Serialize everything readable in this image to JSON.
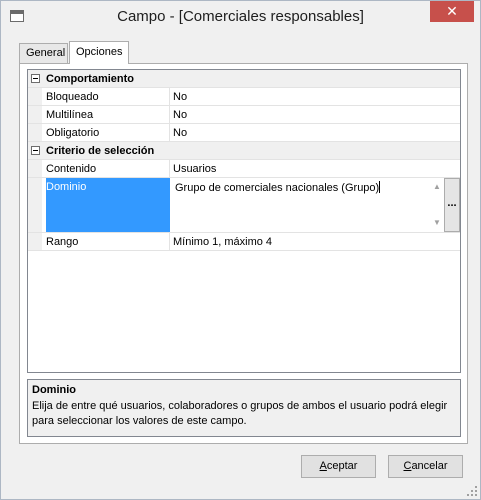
{
  "window": {
    "title": "Campo - [Comerciales responsables]",
    "close_label": "✕"
  },
  "tabs": [
    {
      "label": "General"
    },
    {
      "label": "Opciones"
    }
  ],
  "grid": {
    "categories": [
      {
        "label": "Comportamiento",
        "expander": "−"
      },
      {
        "label": "Criterio de selección",
        "expander": "−"
      }
    ],
    "properties": {
      "bloqueado": {
        "name": "Bloqueado",
        "value": "No"
      },
      "multilinea": {
        "name": "Multilínea",
        "value": "No"
      },
      "obligatorio": {
        "name": "Obligatorio",
        "value": "No"
      },
      "contenido": {
        "name": "Contenido",
        "value": "Usuarios"
      },
      "dominio": {
        "name": "Dominio",
        "value": "Grupo de comerciales nacionales (Grupo)"
      },
      "rango": {
        "name": "Rango",
        "value": "Mínimo 1, máximo 4"
      }
    },
    "ellipsis_label": "..."
  },
  "help": {
    "title": "Dominio",
    "text": "Elija de entre qué usuarios, colaboradores o grupos de ambos el usuario podrá elegir para seleccionar los valores de este campo."
  },
  "buttons": {
    "accept_prefix": "",
    "accept_mnemonic": "A",
    "accept_rest": "ceptar",
    "cancel_prefix": "",
    "cancel_mnemonic": "C",
    "cancel_rest": "ancelar"
  }
}
